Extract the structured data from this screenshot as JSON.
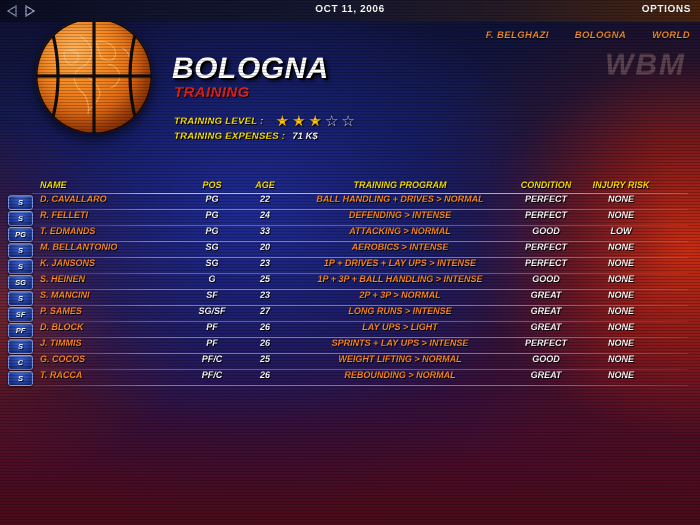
{
  "topbar": {
    "prev_icon": "left-triangle-icon",
    "next_icon": "right-triangle-icon",
    "date": "OCT 11, 2006",
    "options": "OPTIONS"
  },
  "subnav": [
    {
      "label": "F. BELGHAZI"
    },
    {
      "label": "BOLOGNA"
    },
    {
      "label": "WORLD"
    }
  ],
  "watermark": "WBM",
  "header": {
    "team": "BOLOGNA",
    "section": "TRAINING",
    "training_level_label": "TRAINING LEVEL :",
    "training_level_value": 3,
    "training_level_max": 5,
    "training_expenses_label": "TRAINING EXPENSES :",
    "training_expenses_value": "71 K$"
  },
  "colors": {
    "header_text": "#ffe400",
    "name_text": "#ff8a1e",
    "value_text": "#ffffff",
    "section_red": "#e8201c",
    "star_on": "#ffc40d",
    "star_off": "#d8dce6"
  },
  "table": {
    "columns": [
      "NAME",
      "POS",
      "AGE",
      "TRAINING PROGRAM",
      "CONDITION",
      "INJURY RISK"
    ],
    "rows": [
      {
        "badge": "S",
        "name": "D. CAVALLARO",
        "pos": "PG",
        "age": "22",
        "program": "BALL HANDLING + DRIVES > NORMAL",
        "condition": "PERFECT",
        "injury": "NONE"
      },
      {
        "badge": "S",
        "name": "R. FELLETI",
        "pos": "PG",
        "age": "24",
        "program": "DEFENDING > INTENSE",
        "condition": "PERFECT",
        "injury": "NONE"
      },
      {
        "badge": "PG",
        "name": "T. EDMANDS",
        "pos": "PG",
        "age": "33",
        "program": "ATTACKING > NORMAL",
        "condition": "GOOD",
        "injury": "LOW"
      },
      {
        "badge": "S",
        "name": "M. BELLANTONIO",
        "pos": "SG",
        "age": "20",
        "program": "AEROBICS > INTENSE",
        "condition": "PERFECT",
        "injury": "NONE"
      },
      {
        "badge": "S",
        "name": "K. JANSONS",
        "pos": "SG",
        "age": "23",
        "program": "1P + DRIVES + LAY UPS > INTENSE",
        "condition": "PERFECT",
        "injury": "NONE"
      },
      {
        "badge": "SG",
        "name": "S. HEINEN",
        "pos": "G",
        "age": "25",
        "program": "1P + 3P + BALL HANDLING > INTENSE",
        "condition": "GOOD",
        "injury": "NONE"
      },
      {
        "badge": "S",
        "name": "S. MANCINI",
        "pos": "SF",
        "age": "23",
        "program": "2P + 3P > NORMAL",
        "condition": "GREAT",
        "injury": "NONE"
      },
      {
        "badge": "SF",
        "name": "P. SAMES",
        "pos": "SG/SF",
        "age": "27",
        "program": "LONG RUNS > INTENSE",
        "condition": "GREAT",
        "injury": "NONE"
      },
      {
        "badge": "PF",
        "name": "D. BLOCK",
        "pos": "PF",
        "age": "26",
        "program": "LAY UPS > LIGHT",
        "condition": "GREAT",
        "injury": "NONE"
      },
      {
        "badge": "S",
        "name": "J. TIMMIS",
        "pos": "PF",
        "age": "26",
        "program": "SPRINTS + LAY UPS > INTENSE",
        "condition": "PERFECT",
        "injury": "NONE"
      },
      {
        "badge": "C",
        "name": "G. COCOS",
        "pos": "PF/C",
        "age": "25",
        "program": "WEIGHT LIFTING > NORMAL",
        "condition": "GOOD",
        "injury": "NONE"
      },
      {
        "badge": "S",
        "name": "T. RACCA",
        "pos": "PF/C",
        "age": "26",
        "program": "REBOUNDING > NORMAL",
        "condition": "GREAT",
        "injury": "NONE"
      }
    ]
  }
}
